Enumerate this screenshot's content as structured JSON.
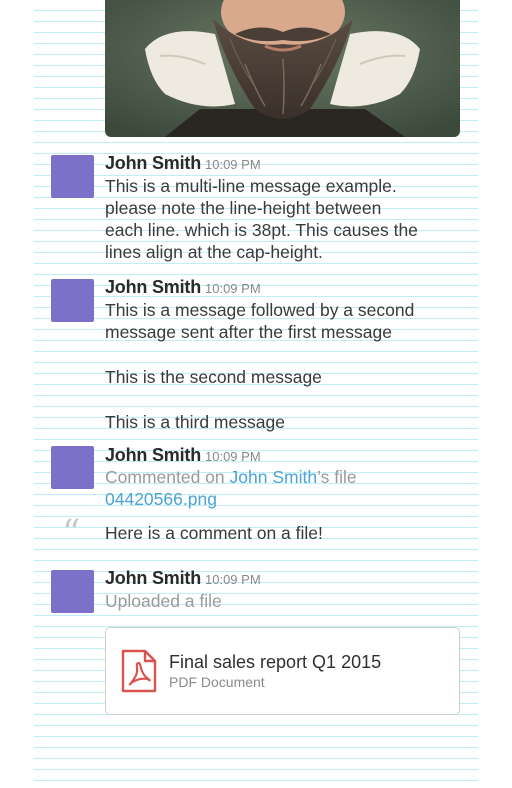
{
  "colors": {
    "avatar": "#7b71c9",
    "link": "#4aa4d6",
    "guide_lines": "#bfeef4",
    "pdf_icon": "#d9534f"
  },
  "messages": [
    {
      "sender": "John Smith",
      "time": "10:09 PM",
      "lines": [
        "This is a multi-line message example.",
        "please note the line-height between",
        "each line. which is 38pt. This causes the",
        "lines align at the cap-height."
      ]
    },
    {
      "sender": "John Smith",
      "time": "10:09 PM",
      "lines": [
        "This is a message followed by a second",
        "message sent after the first message"
      ],
      "followups": [
        "This is the second message",
        "This is a third message"
      ]
    },
    {
      "sender": "John Smith",
      "time": "10:09 PM",
      "commented_prefix": "Commented on ",
      "commented_user": "John Smith",
      "commented_suffix": "’s file",
      "file_link": "04420566.png",
      "comment_quote_glyph": "“",
      "comment": "Here is a comment on a file!"
    },
    {
      "sender": "John Smith",
      "time": "10:09 PM",
      "action": "Uploaded a file",
      "file": {
        "name": "Final sales report Q1 2015",
        "type": "PDF Document",
        "icon": "pdf-file-icon"
      }
    }
  ]
}
